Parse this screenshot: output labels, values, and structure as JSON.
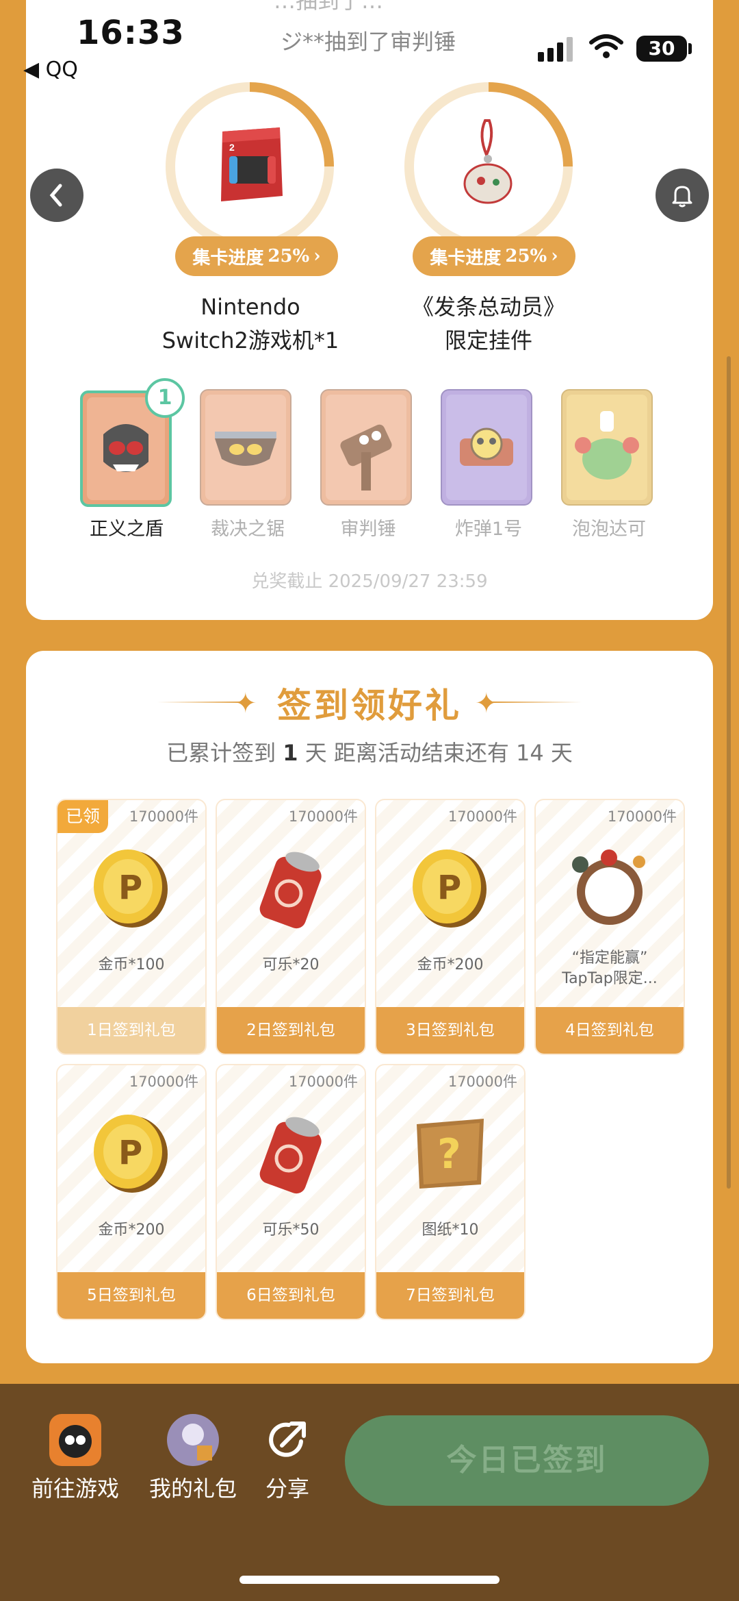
{
  "status_bar": {
    "time": "16:33",
    "back_app": "◀ QQ",
    "battery": "30"
  },
  "ticker": {
    "top_line": "…抽到了…",
    "line": "ジ**抽到了审判锤"
  },
  "prizes": [
    {
      "progress_label": "集卡进度",
      "progress": "25%",
      "name_line1": "Nintendo",
      "name_line2": "Switch2游戏机*1"
    },
    {
      "progress_label": "集卡进度",
      "progress": "25%",
      "name_line1": "《发条总动员》",
      "name_line2": "限定挂件"
    }
  ],
  "cards": [
    {
      "label": "正义之盾",
      "count": "1",
      "owned": true
    },
    {
      "label": "裁决之锯",
      "owned": false
    },
    {
      "label": "审判锤",
      "owned": false
    },
    {
      "label": "炸弹1号",
      "owned": false
    },
    {
      "label": "泡泡达可",
      "owned": false
    }
  ],
  "deadline": "兑奖截止 2025/09/27 23:59",
  "signin": {
    "title": "签到领好礼",
    "sub_prefix": "已累计签到",
    "sub_days": "1",
    "sub_mid": "天  距离活动结束还有 14 天",
    "claimed_tag": "已领",
    "gifts": [
      {
        "stock": "170000件",
        "label": "金币*100",
        "bar": "1日签到礼包",
        "icon": "coin-icon"
      },
      {
        "stock": "170000件",
        "label": "可乐*20",
        "bar": "2日签到礼包",
        "icon": "cola-icon"
      },
      {
        "stock": "170000件",
        "label": "金币*200",
        "bar": "3日签到礼包",
        "icon": "coin-icon"
      },
      {
        "stock": "170000件",
        "label": "“指定能赢”",
        "label2": "TapTap限定...",
        "bar": "4日签到礼包",
        "icon": "frame-icon"
      },
      {
        "stock": "170000件",
        "label": "金币*200",
        "bar": "5日签到礼包",
        "icon": "coin-icon"
      },
      {
        "stock": "170000件",
        "label": "可乐*50",
        "bar": "6日签到礼包",
        "icon": "cola-icon"
      },
      {
        "stock": "170000件",
        "label": "图纸*10",
        "bar": "7日签到礼包",
        "icon": "blueprint-icon"
      }
    ]
  },
  "bottom": {
    "game": "前往游戏",
    "gifts": "我的礼包",
    "share": "分享",
    "signed": "今日已签到"
  },
  "colors": {
    "accent": "#E09C3C",
    "bottom_bg": "#6C4A23",
    "signed_btn": "#5E8E62"
  }
}
